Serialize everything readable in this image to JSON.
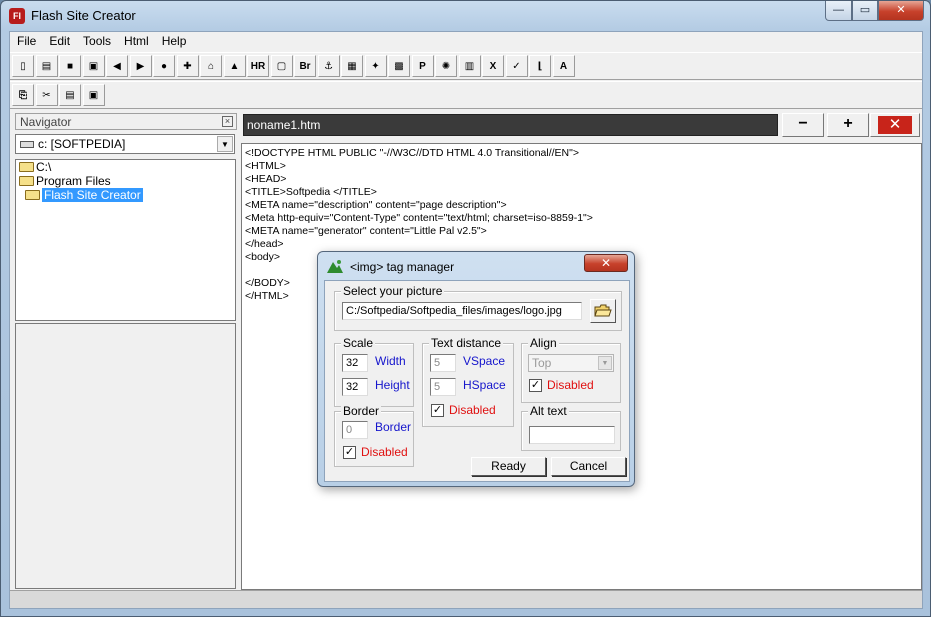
{
  "app": {
    "title": "Flash Site Creator",
    "icon_text": "Fl"
  },
  "window_controls": {
    "minimize": "—",
    "maximize": "▭",
    "close": "✕"
  },
  "menu": [
    "File",
    "Edit",
    "Tools",
    "Html",
    "Help"
  ],
  "toolbar1": [
    {
      "name": "new-page-icon",
      "glyph": "▯"
    },
    {
      "name": "open-icon",
      "glyph": "▤"
    },
    {
      "name": "save-icon",
      "glyph": "■"
    },
    {
      "name": "save-as-icon",
      "glyph": "▣"
    },
    {
      "name": "back-arrow-icon",
      "glyph": "◀"
    },
    {
      "name": "forward-arrow-icon",
      "glyph": "▶"
    },
    {
      "name": "globe-icon",
      "glyph": "●"
    },
    {
      "name": "add-icon",
      "glyph": "✚"
    },
    {
      "name": "tree-icon",
      "glyph": "⌂"
    },
    {
      "name": "image-tag-icon",
      "glyph": "▲"
    },
    {
      "name": "hr-icon",
      "glyph": "HR"
    },
    {
      "name": "frame-icon",
      "glyph": "▢"
    },
    {
      "name": "br-icon",
      "glyph": "Br"
    },
    {
      "name": "anchor-icon",
      "glyph": "⚓"
    },
    {
      "name": "table-icon",
      "glyph": "▦"
    },
    {
      "name": "flash-icon",
      "glyph": "✦"
    },
    {
      "name": "form-icon",
      "glyph": "▩"
    },
    {
      "name": "paragraph-icon",
      "glyph": "P"
    },
    {
      "name": "color-icon",
      "glyph": "✺"
    },
    {
      "name": "column-icon",
      "glyph": "▥"
    },
    {
      "name": "remove-icon",
      "glyph": "X"
    },
    {
      "name": "check-icon",
      "glyph": "✓"
    },
    {
      "name": "align-icon",
      "glyph": "⌊"
    },
    {
      "name": "font-icon",
      "glyph": "A"
    }
  ],
  "toolbar2": [
    {
      "name": "copy-icon",
      "glyph": "⎘"
    },
    {
      "name": "cut-icon",
      "glyph": "✂"
    },
    {
      "name": "paste-icon",
      "glyph": "▤"
    },
    {
      "name": "preview-icon",
      "glyph": "▣"
    }
  ],
  "navigator": {
    "title": "Navigator",
    "close": "×",
    "drive": "c: [SOFTPEDIA]",
    "folders": [
      {
        "label": "C:\\",
        "selected": false,
        "indent": 0
      },
      {
        "label": "Program Files",
        "selected": false,
        "indent": 0
      },
      {
        "label": "Flash Site Creator",
        "selected": true,
        "indent": 1
      }
    ]
  },
  "editor": {
    "filename": "noname1.htm",
    "zoom_out": "−",
    "zoom_in": "+",
    "close": "✕",
    "code_lines": [
      "<!DOCTYPE HTML PUBLIC \"-//W3C//DTD HTML 4.0 Transitional//EN\">",
      "<HTML>",
      "<HEAD>",
      "<TITLE>Softpedia </TITLE>",
      "<META name=\"description\" content=\"page description\">",
      "<Meta http-equiv=\"Content-Type\" content=\"text/html; charset=iso-8859-1\">",
      "<META name=\"generator\" content=\"Little Pal v2.5\">",
      "</head>",
      "<body>",
      "",
      "</BODY>",
      "</HTML>"
    ]
  },
  "dialog": {
    "title": "<img> tag manager",
    "close": "✕",
    "picture": {
      "legend": "Select your picture",
      "path": "C:/Softpedia/Softpedia_files/images/logo.jpg"
    },
    "scale": {
      "legend": "Scale",
      "width_value": "32",
      "width_label": "Width",
      "height_value": "32",
      "height_label": "Height"
    },
    "text_distance": {
      "legend": "Text distance",
      "vspace_value": "5",
      "vspace_label": "VSpace",
      "hspace_value": "5",
      "hspace_label": "HSpace",
      "disabled_label": "Disabled",
      "disabled_checked": true
    },
    "align": {
      "legend": "Align",
      "value": "Top",
      "disabled_label": "Disabled",
      "disabled_checked": true
    },
    "border": {
      "legend": "Border",
      "value": "0",
      "label": "Border",
      "disabled_label": "Disabled",
      "disabled_checked": true
    },
    "alt_text": {
      "legend": "Alt text",
      "value": ""
    },
    "ready_label": "Ready",
    "cancel_label": "Cancel",
    "check_glyph": "✓"
  }
}
